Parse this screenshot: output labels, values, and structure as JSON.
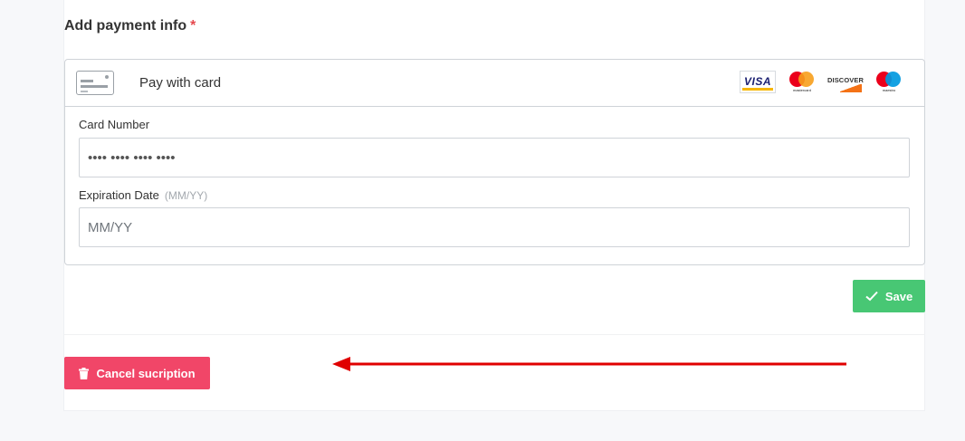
{
  "payment": {
    "title": "Add payment info",
    "required_mark": "*",
    "method_label": "Pay with card",
    "brands": [
      "visa-icon",
      "mastercard-icon",
      "discover-icon",
      "maestro-icon"
    ],
    "card_number": {
      "label": "Card Number",
      "value": "•••• •••• •••• ••••"
    },
    "expiration": {
      "label": "Expiration Date",
      "hint": "(MM/YY)",
      "placeholder": "MM/YY"
    },
    "save_label": "Save",
    "cancel_label": "Cancel sucription"
  },
  "brand_logos": {
    "visa": "VISA",
    "mastercard": "mastercard",
    "discover": "DISCOVER",
    "maestro": "maestro"
  },
  "colors": {
    "save": "#48c774",
    "cancel": "#f14668",
    "arrow": "#e00000",
    "required": "#e5484d"
  }
}
